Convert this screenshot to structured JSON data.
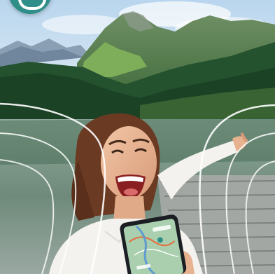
{
  "brand": {
    "accent_color": "#2f8f88",
    "logo_icon": "app-logo-icon"
  },
  "scene": {
    "sky_color": "#cfe3f2",
    "mountain_color": "#4f7d4a",
    "forest_color": "#1f4a2a",
    "lake_color": "#7f9a8a",
    "dock_color": "#a3a7a4",
    "shirt_color": "#f4f2ee",
    "phone_screen_color": "#9fc7a5"
  }
}
